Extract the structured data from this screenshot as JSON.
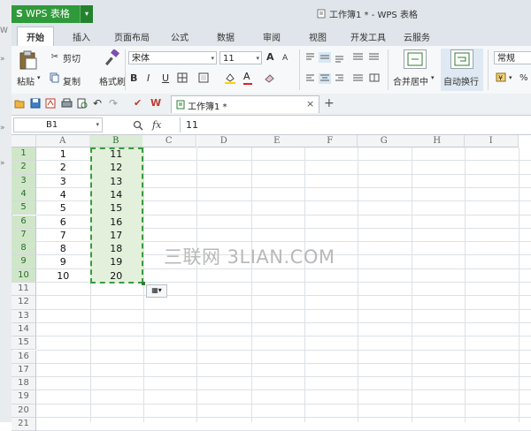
{
  "background_window": {
    "letters": [
      "W",
      "»",
      "»",
      "»"
    ]
  },
  "app": {
    "name": "WPS 表格",
    "logo_letter": "S",
    "menu_arrow": "▾"
  },
  "document": {
    "title": "工作簿1 * - WPS 表格",
    "tab_label": "工作簿1 *",
    "close_symbol": "×",
    "add_symbol": "+"
  },
  "ribbon_tabs": [
    "开始",
    "插入",
    "页面布局",
    "公式",
    "数据",
    "审阅",
    "视图",
    "开发工具",
    "云服务"
  ],
  "active_tab": "开始",
  "ribbon": {
    "paste": "粘贴",
    "cut": "剪切",
    "copy": "复制",
    "format_painter": "格式刷",
    "font_name": "宋体",
    "font_size": "11",
    "bold": "B",
    "italic": "I",
    "underline": "U",
    "grow_font": "A",
    "shrink_font": "A",
    "merge_center": "合并居中",
    "wrap_text": "自动换行",
    "number_format": "常规",
    "percent": "%",
    "dropdown_arrow": "▾"
  },
  "formula_bar": {
    "cell_ref": "B1",
    "fx": "fx",
    "value": "11"
  },
  "columns": [
    "A",
    "B",
    "C",
    "D",
    "E",
    "F",
    "G",
    "H",
    "I"
  ],
  "selected_column": "B",
  "rows": [
    "1",
    "2",
    "3",
    "4",
    "5",
    "6",
    "7",
    "8",
    "9",
    "10",
    "11",
    "12",
    "13",
    "14",
    "15",
    "16",
    "17",
    "18",
    "19",
    "20",
    "21"
  ],
  "selected_rows": [
    "1",
    "2",
    "3",
    "4",
    "5",
    "6",
    "7",
    "8",
    "9",
    "10"
  ],
  "cells": {
    "A": [
      "1",
      "2",
      "3",
      "4",
      "5",
      "6",
      "7",
      "8",
      "9",
      "10"
    ],
    "B": [
      "11",
      "12",
      "13",
      "14",
      "15",
      "16",
      "17",
      "18",
      "19",
      "20"
    ]
  },
  "watermark": "三联网 3LIAN.COM",
  "colors": {
    "accent_green": "#2e9a3a",
    "selection_fill": "#e3f1dc",
    "selection_border": "#3b9b42"
  }
}
